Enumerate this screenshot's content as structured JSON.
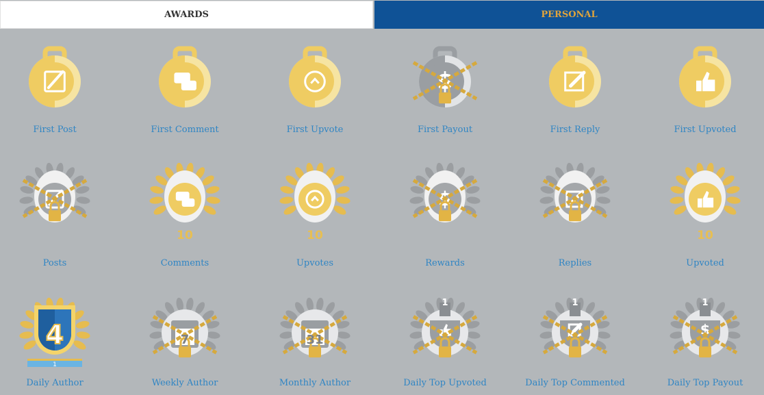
{
  "tabs": {
    "awards": "AWARDS",
    "personal": "PERSONAL"
  },
  "colors": {
    "gold": "#e8bf52",
    "silver": "#8f9397",
    "label": "#2f85c4",
    "tab_active_bg": "#0f5296",
    "tab_active_text": "#e0a43b"
  },
  "rows": [
    [
      {
        "label": "First Post",
        "icon": "quill-medal-icon",
        "locked": false
      },
      {
        "label": "First Comment",
        "icon": "chat-medal-icon",
        "locked": false
      },
      {
        "label": "First Upvote",
        "icon": "upvote-medal-icon",
        "locked": false
      },
      {
        "label": "First Payout",
        "icon": "dollar-medal-icon",
        "locked": true
      },
      {
        "label": "First Reply",
        "icon": "edit-medal-icon",
        "locked": false
      },
      {
        "label": "First Upvoted",
        "icon": "thumbs-up-medal-icon",
        "locked": false
      }
    ],
    [
      {
        "label": "Posts",
        "icon": "quill-wreath-icon",
        "locked": true,
        "badge": ""
      },
      {
        "label": "Comments",
        "icon": "chat-wreath-icon",
        "locked": false,
        "badge": "10"
      },
      {
        "label": "Upvotes",
        "icon": "upvote-wreath-icon",
        "locked": false,
        "badge": "10"
      },
      {
        "label": "Rewards",
        "icon": "dollar-wreath-icon",
        "locked": true,
        "badge": ""
      },
      {
        "label": "Replies",
        "icon": "edit-wreath-icon",
        "locked": true,
        "badge": ""
      },
      {
        "label": "Upvoted",
        "icon": "thumbs-up-wreath-icon",
        "locked": false,
        "badge": "10"
      }
    ],
    [
      {
        "label": "Daily Author",
        "icon": "daily-author-shield-icon",
        "locked": false,
        "num": "4",
        "ribbon": "1"
      },
      {
        "label": "Weekly Author",
        "icon": "calendar-7-icon",
        "locked": true,
        "num": "7"
      },
      {
        "label": "Monthly Author",
        "icon": "calendar-31-icon",
        "locked": true,
        "num": "31"
      },
      {
        "label": "Daily Top Upvoted",
        "icon": "trophy-thumbs-up-icon",
        "locked": true,
        "num": "1"
      },
      {
        "label": "Daily Top Commented",
        "icon": "trophy-edit-icon",
        "locked": true,
        "num": "1"
      },
      {
        "label": "Daily Top Payout",
        "icon": "trophy-dollar-icon",
        "locked": true,
        "num": "1"
      }
    ]
  ]
}
